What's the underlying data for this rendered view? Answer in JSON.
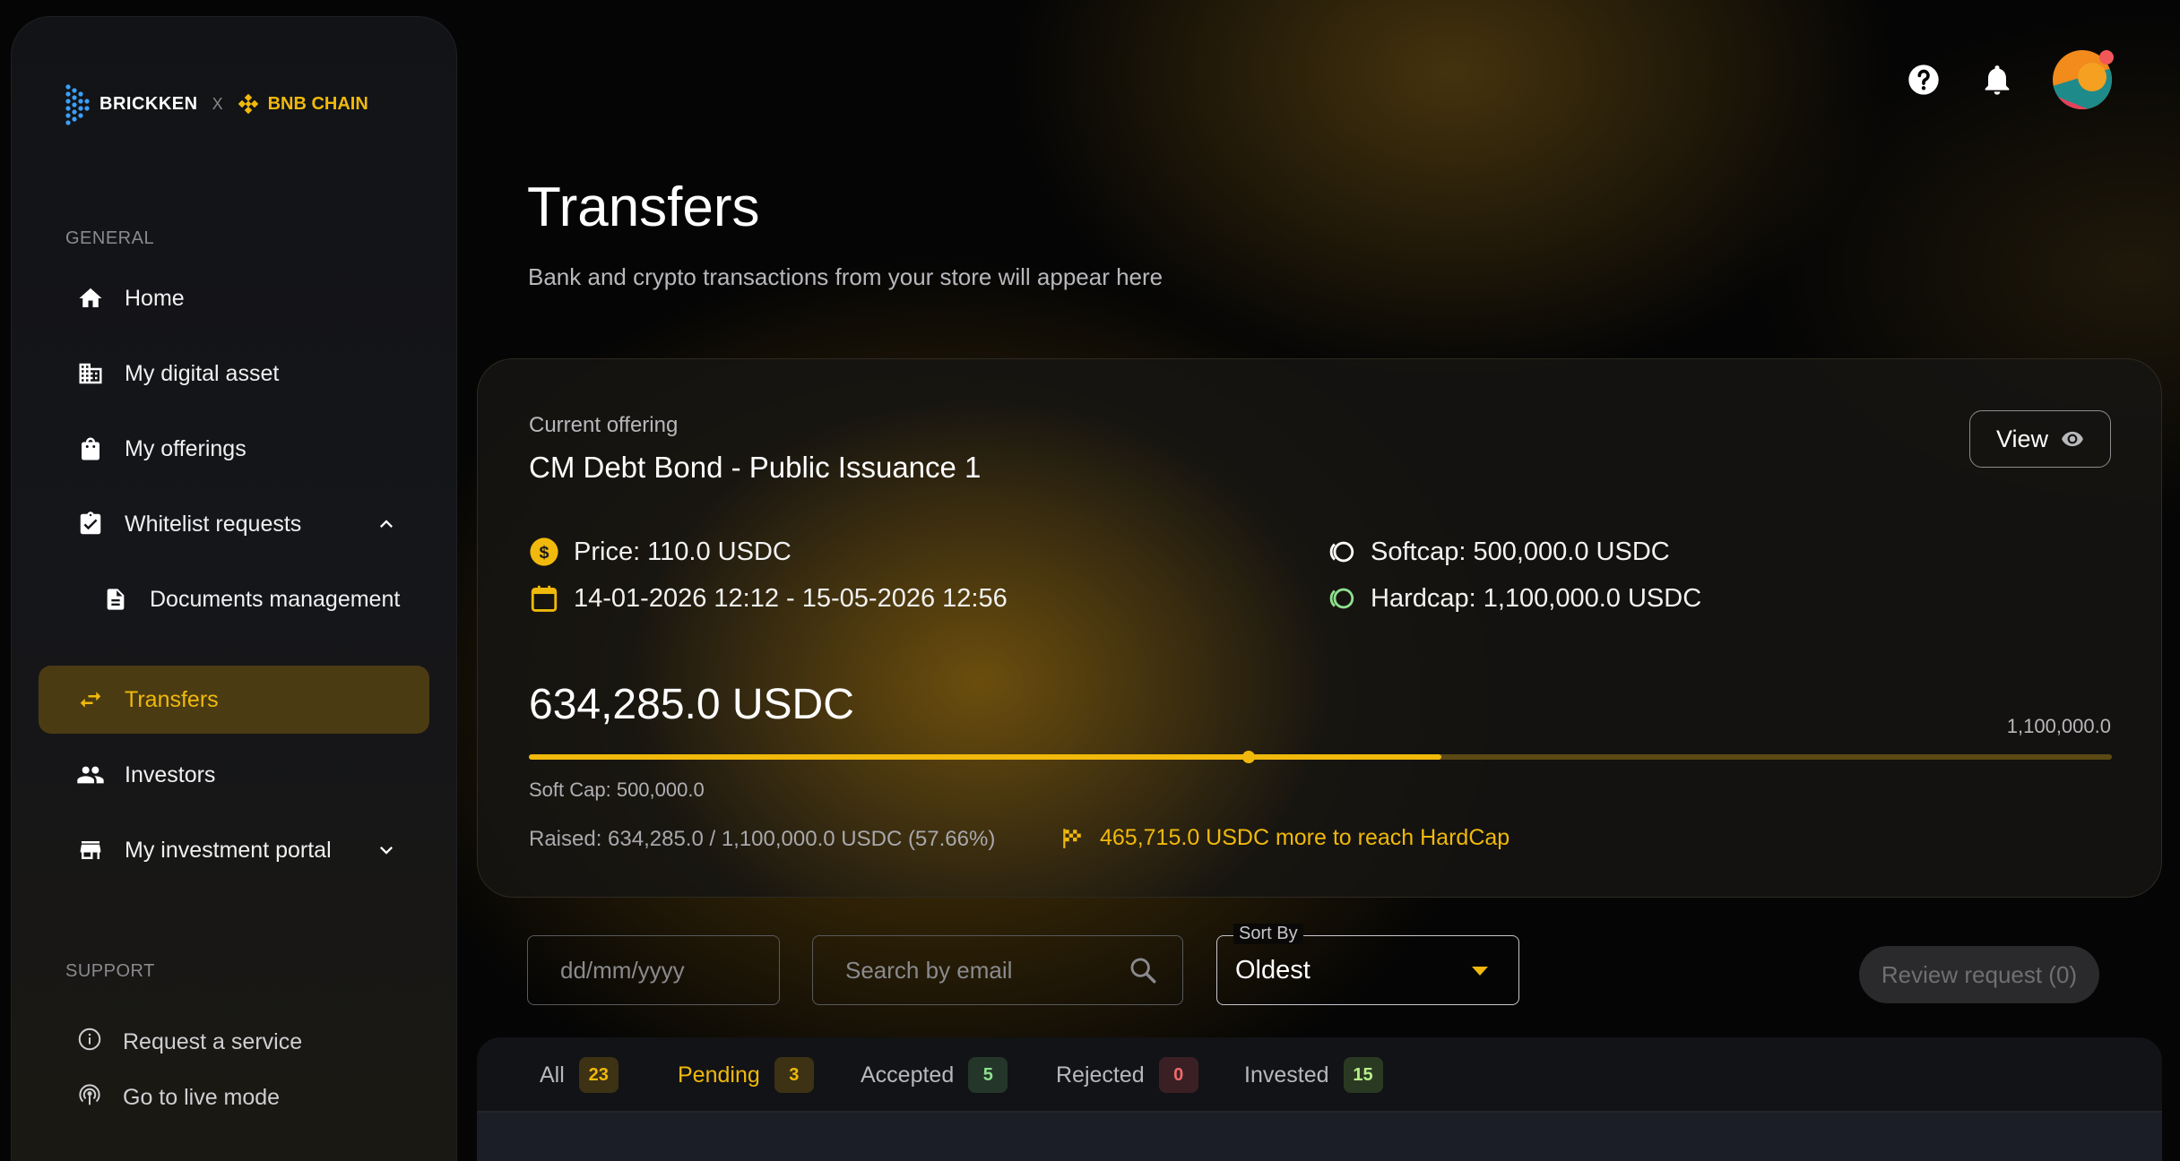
{
  "logo": {
    "brand": "BRICKKEN",
    "separator": "X",
    "partner": "BNB CHAIN"
  },
  "sidebar": {
    "general_title": "GENERAL",
    "items": [
      {
        "label": "Home",
        "icon": "home-icon"
      },
      {
        "label": "My digital asset",
        "icon": "building-icon"
      },
      {
        "label": "My offerings",
        "icon": "shopping-bag-icon"
      },
      {
        "label": "Whitelist requests",
        "icon": "clipboard-check-icon",
        "expanded": true
      },
      {
        "label": "Documents management",
        "icon": "document-icon"
      },
      {
        "label": "Transfers",
        "icon": "swap-arrows-icon",
        "active": true
      },
      {
        "label": "Investors",
        "icon": "people-icon"
      },
      {
        "label": "My investment portal",
        "icon": "store-icon",
        "expanded": false
      }
    ],
    "support_title": "SUPPORT",
    "support_items": [
      {
        "label": "Request a service",
        "icon": "info-circle-icon"
      },
      {
        "label": "Go to live mode",
        "icon": "broadcast-icon"
      }
    ]
  },
  "header": {
    "title": "Transfers",
    "subtitle": "Bank and crypto transactions from your store will appear here"
  },
  "offering": {
    "label": "Current offering",
    "name": "CM Debt Bond - Public Issuance 1",
    "view_label": "View",
    "price": "Price: 110.0 USDC",
    "dates": "14-01-2026 12:12 - 15-05-2026 12:56",
    "softcap": "Softcap: 500,000.0 USDC",
    "hardcap": "Hardcap: 1,100,000.0 USDC",
    "raised_amount": "634,285.0 USDC",
    "max_label": "1,100,000.0",
    "progress_fraction": 0.5766,
    "softcap_fraction": 0.4545,
    "softcap_text": "Soft Cap: 500,000.0",
    "raised_text": "Raised:  634,285.0 / 1,100,000.0 USDC (57.66%)",
    "reach_text": "465,715.0 USDC more to reach HardCap"
  },
  "filters": {
    "date_placeholder": "dd/mm/yyyy",
    "search_placeholder": "Search by email",
    "sort_label": "Sort By",
    "sort_value": "Oldest",
    "review_label": "Review request (0)"
  },
  "tabs": [
    {
      "label": "All",
      "count": "23",
      "color": "#f0b90b",
      "bg": "#3d3214"
    },
    {
      "label": "Pending",
      "count": "3",
      "color": "#f0b90b",
      "bg": "#3d3214",
      "active": true
    },
    {
      "label": "Accepted",
      "count": "5",
      "color": "#8fe08f",
      "bg": "#24362a"
    },
    {
      "label": "Rejected",
      "count": "0",
      "color": "#f06a6a",
      "bg": "#3a2024"
    },
    {
      "label": "Invested",
      "count": "15",
      "color": "#b8f08a",
      "bg": "#2a3a22"
    }
  ],
  "colors": {
    "accent": "#f0b90b",
    "active_nav_bg": "#4a3b12",
    "sidebar_bg": "#141518"
  }
}
